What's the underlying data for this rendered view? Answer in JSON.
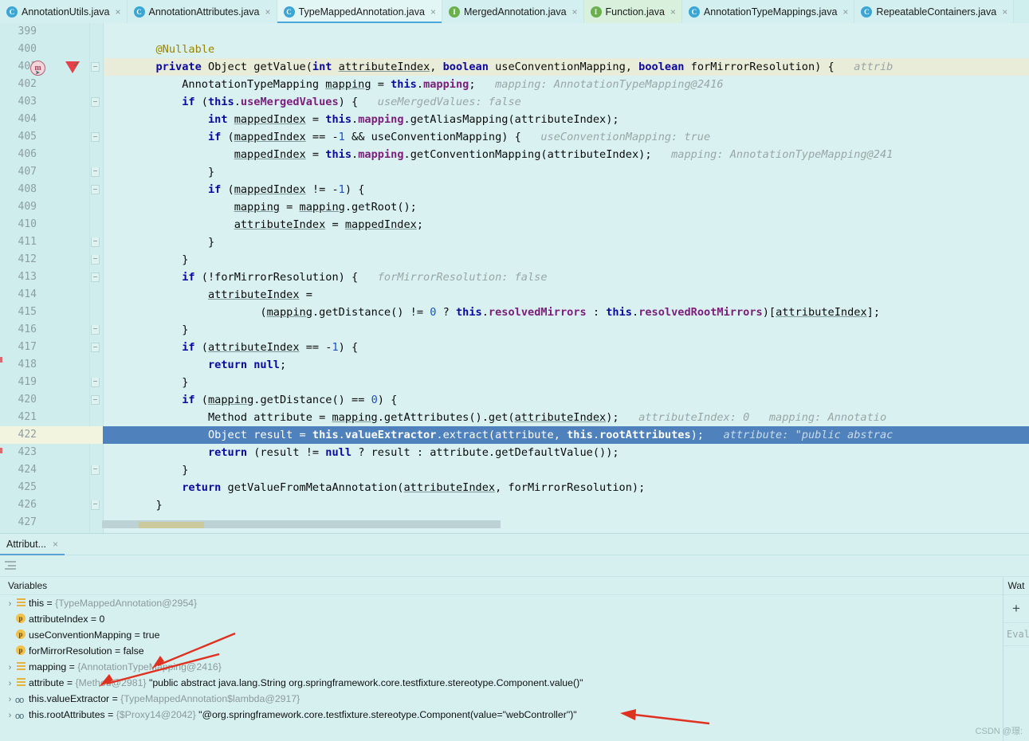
{
  "tabs": [
    {
      "label": "AnnotationUtils.java",
      "icon": "class-icon",
      "icon_letter": "C",
      "icon_kind": "c",
      "active": false,
      "closable": true
    },
    {
      "label": "AnnotationAttributes.java",
      "icon": "class-icon",
      "icon_letter": "C",
      "icon_kind": "c",
      "active": false,
      "closable": true
    },
    {
      "label": "TypeMappedAnnotation.java",
      "icon": "class-icon",
      "icon_letter": "C",
      "icon_kind": "c",
      "active": true,
      "closable": true
    },
    {
      "label": "MergedAnnotation.java",
      "icon": "interface-icon",
      "icon_letter": "I",
      "icon_kind": "i",
      "active": false,
      "closable": true
    },
    {
      "label": "Function.java",
      "icon": "interface-icon",
      "icon_letter": "I",
      "icon_kind": "i",
      "active": false,
      "closable": true
    },
    {
      "label": "AnnotationTypeMappings.java",
      "icon": "class-icon",
      "icon_letter": "C",
      "icon_kind": "c",
      "active": false,
      "closable": true
    },
    {
      "label": "RepeatableContainers.java",
      "icon": "class-icon",
      "icon_letter": "C",
      "icon_kind": "c",
      "active": false,
      "closable": true
    }
  ],
  "editor": {
    "lines": [
      {
        "num": "399",
        "html": ""
      },
      {
        "num": "400",
        "html": "        <span class='ann'>@Nullable</span>"
      },
      {
        "num": "401",
        "method_decl": true,
        "marker": "method",
        "breakpoint": true,
        "fold": true,
        "html": "        <span class='kw'>private</span> Object getValue(<span class='kw'>int</span> <span class='und'>attributeIndex</span>, <span class='kw'>boolean</span> useConventionMapping, <span class='kw'>boolean</span> forMirrorResolution) {   <span class='hint'>attrib</span>"
      },
      {
        "num": "402",
        "html": "            AnnotationTypeMapping <span class='und'>mapping</span> = <span class='kw'>this</span>.<span class='fld'>mapping</span>;   <span class='hint'>mapping: AnnotationTypeMapping@2416</span>"
      },
      {
        "num": "403",
        "fold": true,
        "html": "            <span class='kw'>if</span> (<span class='kw'>this</span>.<span class='fld'>useMergedValues</span>) {   <span class='hint'>useMergedValues: false</span>"
      },
      {
        "num": "404",
        "html": "                <span class='kw'>int</span> <span class='und'>mappedIndex</span> = <span class='kw'>this</span>.<span class='fld'>mapping</span>.getAliasMapping(attributeIndex);"
      },
      {
        "num": "405",
        "fold": true,
        "html": "                <span class='kw'>if</span> (<span class='und'>mappedIndex</span> == -<span class='num'>1</span> &amp;&amp; useConventionMapping) {   <span class='hint'>useConventionMapping: true</span>"
      },
      {
        "num": "406",
        "html": "                    <span class='und'>mappedIndex</span> = <span class='kw'>this</span>.<span class='fld'>mapping</span>.getConventionMapping(attributeIndex);   <span class='hint'>mapping: AnnotationTypeMapping@241</span>"
      },
      {
        "num": "407",
        "fold": true,
        "fold_end": true,
        "html": "                }"
      },
      {
        "num": "408",
        "fold": true,
        "html": "                <span class='kw'>if</span> (<span class='und'>mappedIndex</span> != -<span class='num'>1</span>) {"
      },
      {
        "num": "409",
        "html": "                    <span class='und'>mapping</span> = <span class='und'>mapping</span>.getRoot();"
      },
      {
        "num": "410",
        "html": "                    <span class='und'>attributeIndex</span> = <span class='und'>mappedIndex</span>;"
      },
      {
        "num": "411",
        "fold": true,
        "fold_end": true,
        "html": "                }"
      },
      {
        "num": "412",
        "fold": true,
        "fold_end": true,
        "html": "            }"
      },
      {
        "num": "413",
        "fold": true,
        "html": "            <span class='kw'>if</span> (!forMirrorResolution) {   <span class='hint'>forMirrorResolution: false</span>"
      },
      {
        "num": "414",
        "html": "                <span class='und'>attributeIndex</span> ="
      },
      {
        "num": "415",
        "html": "                        (<span class='und'>mapping</span>.getDistance() != <span class='num'>0</span> ? <span class='kw'>this</span>.<span class='fld'>resolvedMirrors</span> : <span class='kw'>this</span>.<span class='fld'>resolvedRootMirrors</span>)[<span class='und'>attributeIndex</span>];"
      },
      {
        "num": "416",
        "fold": true,
        "fold_end": true,
        "html": "            }"
      },
      {
        "num": "417",
        "fold": true,
        "html": "            <span class='kw'>if</span> (<span class='und'>attributeIndex</span> == -<span class='num'>1</span>) {"
      },
      {
        "num": "418",
        "html": "                <span class='kw'>return</span> <span class='kw'>null</span>;"
      },
      {
        "num": "419",
        "fold": true,
        "fold_end": true,
        "html": "            }"
      },
      {
        "num": "420",
        "fold": true,
        "html": "            <span class='kw'>if</span> (<span class='und'>mapping</span>.getDistance() == <span class='num'>0</span>) {"
      },
      {
        "num": "421",
        "html": "                Method attribute = <span class='und'>mapping</span>.getAttributes().get(<span class='und'>attributeIndex</span>);   <span class='hint'>attributeIndex: 0</span>   <span class='hint'>mapping: Annotatio</span>"
      },
      {
        "num": "422",
        "current": true,
        "html": "                Object result = <span class='kw'>this</span>.<span class='fld'>valueExtractor</span>.extract(attribute, <span class='kw'>this</span>.<span class='fld'>rootAttributes</span>);   <span class='hint'>attribute: \"public abstrac</span>"
      },
      {
        "num": "423",
        "html": "                <span class='kw'>return</span> (result != <span class='kw'>null</span> ? result : attribute.getDefaultValue());"
      },
      {
        "num": "424",
        "fold": true,
        "fold_end": true,
        "html": "            }"
      },
      {
        "num": "425",
        "html": "            <span class='kw'>return</span> getValueFromMetaAnnotation(<span class='und'>attributeIndex</span>, forMirrorResolution);"
      },
      {
        "num": "426",
        "fold": true,
        "fold_end": true,
        "html": "        }"
      },
      {
        "num": "427",
        "html": ""
      }
    ]
  },
  "debug": {
    "tab": {
      "label": "Attribut...",
      "close": "×"
    },
    "variables": {
      "header": "Variables",
      "rows": [
        {
          "expandable": true,
          "icon": "object-icon",
          "name": "this",
          "eq": "=",
          "type": "{TypeMappedAnnotation@2954}",
          "value": ""
        },
        {
          "expandable": false,
          "icon": "parameter-icon",
          "name": "attributeIndex",
          "eq": "=",
          "type": "",
          "value": "0"
        },
        {
          "expandable": false,
          "icon": "parameter-icon",
          "name": "useConventionMapping",
          "eq": "=",
          "type": "",
          "value": "true"
        },
        {
          "expandable": false,
          "icon": "parameter-icon",
          "name": "forMirrorResolution",
          "eq": "=",
          "type": "",
          "value": "false"
        },
        {
          "expandable": true,
          "icon": "object-icon",
          "name": "mapping",
          "eq": "=",
          "type": "{AnnotationTypeMapping@2416}",
          "value": ""
        },
        {
          "expandable": true,
          "icon": "object-icon",
          "name": "attribute",
          "eq": "=",
          "type": "{Method@2981}",
          "value": "\"public abstract java.lang.String org.springframework.core.testfixture.stereotype.Component.value()\""
        },
        {
          "expandable": true,
          "icon": "field-icon",
          "name": "this.valueExtractor",
          "eq": "=",
          "type": "{TypeMappedAnnotation$lambda@2917}",
          "value": ""
        },
        {
          "expandable": true,
          "icon": "field-icon",
          "name": "this.rootAttributes",
          "eq": "=",
          "type": "{$Proxy14@2042}",
          "value": "\"@org.springframework.core.testfixture.stereotype.Component(value=\"webController\")\""
        }
      ]
    },
    "watches": {
      "header": "Wat",
      "add_label": "+",
      "eval_placeholder": "Eval"
    }
  },
  "watermark": "CSDN @璟:",
  "colors": {
    "editor_bg": "#d9f1f1",
    "gutter_bg": "#cfeded",
    "current_line_selection": "#4f81bd",
    "current_line_gutter": "#f2f4e0",
    "tab_active_underline": "#4aa8d8",
    "breakpoint": "#e8404a",
    "annotation": "#9a8300",
    "keyword": "#0c09a0",
    "field": "#7b1e7b",
    "hint": "#9aa6a6",
    "arrow_annotation": "#e03020"
  }
}
